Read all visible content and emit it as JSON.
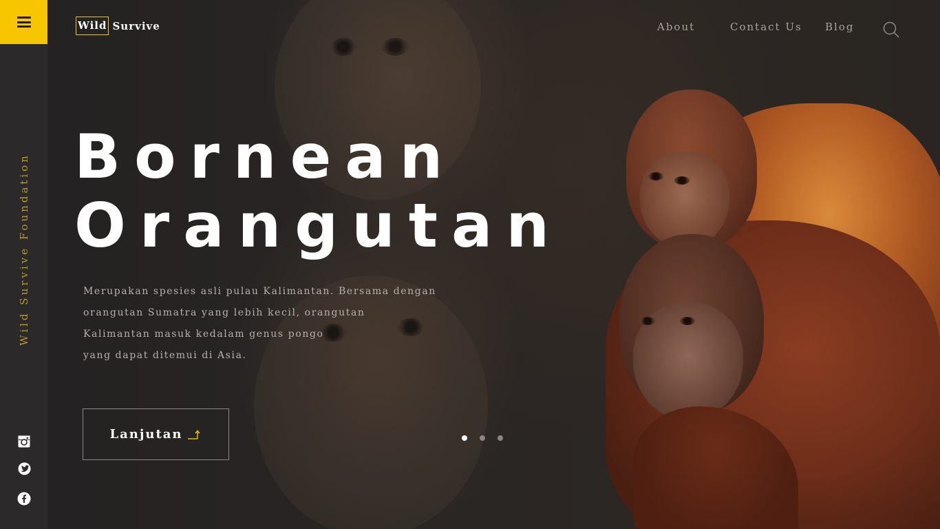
{
  "logo": {
    "part1": "Wild",
    "part2": "Survive"
  },
  "nav": {
    "about": "About",
    "contact": "Contact Us",
    "blog": "Blog"
  },
  "sidebar": {
    "vertical_text": "Wild Survive Foundation"
  },
  "hero": {
    "title_line1": "Bornean",
    "title_line2": "Orangutan",
    "description": [
      "Merupakan spesies asli pulau  Kalimantan. Bersama dengan",
      "orangutan Sumatra yang lebih kecil, orangutan",
      "Kalimantan masuk kedalam genus pongo",
      "yang dapat ditemui di Asia."
    ],
    "cta_label": "Lanjutan"
  },
  "carousel": {
    "total": 3,
    "active_index": 1
  },
  "icons": {
    "menu": "hamburger-menu-icon",
    "search": "search-icon",
    "instagram": "instagram-icon",
    "twitter": "twitter-icon",
    "facebook": "facebook-icon",
    "arrow": "arrow-up-right-icon"
  },
  "colors": {
    "accent": "#f7c600",
    "sidebar": "#2b2929",
    "text_muted": "#a9a39b"
  }
}
